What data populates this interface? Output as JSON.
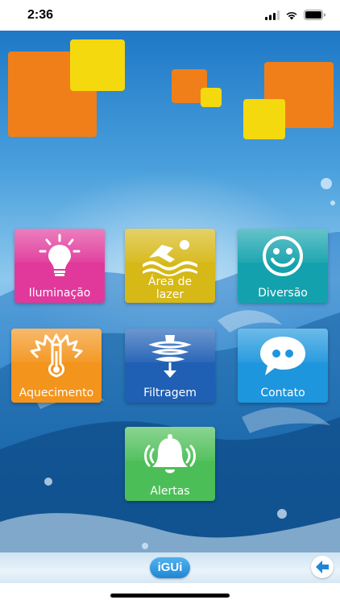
{
  "status_bar": {
    "time": "2:36",
    "icons": [
      "signal-icon",
      "wifi-icon",
      "battery-icon"
    ]
  },
  "colors": {
    "orange": "#f07f1a",
    "yellow": "#f5d90f",
    "iluminacao": "#e0399b",
    "area_lazer": "#d6b816",
    "diversao": "#13a2ad",
    "aquecimento": "#f3941c",
    "filtragem": "#1f5fb4",
    "contato": "#1e96dd",
    "alertas": "#4cbe57"
  },
  "menu": {
    "iluminacao": {
      "label": "Iluminação",
      "icon": "lightbulb-icon"
    },
    "area_lazer": {
      "label_line1": "Área de",
      "label_line2": "lazer",
      "icon": "swimmer-icon"
    },
    "diversao": {
      "label": "Diversão",
      "icon": "smiley-icon"
    },
    "aquecimento": {
      "label": "Aquecimento",
      "icon": "thermometer-icon"
    },
    "filtragem": {
      "label": "Filtragem",
      "icon": "filter-vortex-icon"
    },
    "contato": {
      "label": "Contato",
      "icon": "chat-bubble-icon"
    },
    "alertas": {
      "label": "Alertas",
      "icon": "bell-icon"
    }
  },
  "bottom_bar": {
    "logo": "iGUi",
    "back_icon": "arrow-left-icon"
  }
}
